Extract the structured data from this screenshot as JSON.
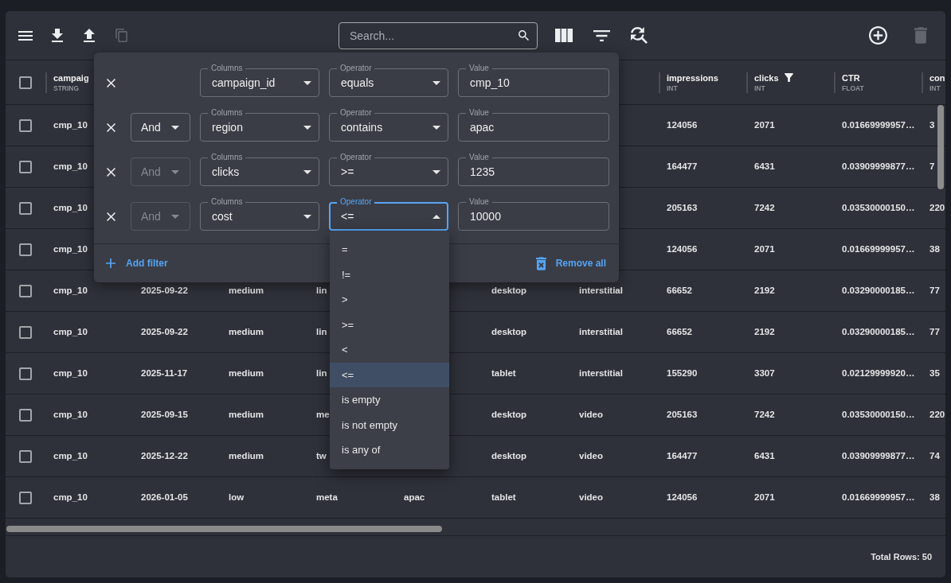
{
  "toolbar": {
    "left_actions": [
      {
        "disabled": false
      },
      {
        "disabled": false
      },
      {
        "disabled": false
      },
      {
        "disabled": true
      }
    ],
    "search": {
      "placeholder": "Search..."
    },
    "right_actions": [
      {
        "disabled": false
      },
      {
        "disabled": true
      }
    ]
  },
  "table": {
    "select_all": {
      "checked": false
    },
    "columns": {
      "column_1": {
        "label": "campaig",
        "type": "STRING",
        "filtered": false
      },
      "column_8": {
        "label": "impressions",
        "type": "INT",
        "filtered": false
      },
      "column_9": {
        "label": "clicks",
        "type": "INT",
        "filtered": true
      },
      "column_10": {
        "label": "CTR",
        "type": "FLOAT",
        "filtered": false
      },
      "column_11": {
        "label": "con",
        "type": "INT",
        "filtered": false
      }
    },
    "rows": [
      {
        "checked": false,
        "column_1": "cmp_10",
        "column_8": "124056",
        "column_9": "2071",
        "column_10": "0.01669999957…",
        "column_11": "3"
      },
      {
        "checked": false,
        "column_1": "cmp_10",
        "column_8": "164477",
        "column_9": "6431",
        "column_10": "0.03909999877…",
        "column_11": "7"
      },
      {
        "checked": false,
        "column_1": "cmp_10",
        "column_8": "205163",
        "column_9": "7242",
        "column_10": "0.03530000150…",
        "column_11": "220"
      },
      {
        "checked": false,
        "column_1": "cmp_10",
        "column_8": "124056",
        "column_9": "2071",
        "column_10": "0.01669999957…",
        "column_11": "38"
      },
      {
        "checked": false,
        "column_1": "cmp_10",
        "column_2": "2025-09-22",
        "column_3": "medium",
        "column_4": "lin",
        "column_6": "desktop",
        "column_7": "interstitial",
        "column_8": "66652",
        "column_9": "2192",
        "column_10": "0.03290000185…",
        "column_11": "77"
      },
      {
        "checked": false,
        "column_1": "cmp_10",
        "column_2": "2025-09-22",
        "column_3": "medium",
        "column_4": "lin",
        "column_6": "desktop",
        "column_7": "interstitial",
        "column_8": "66652",
        "column_9": "2192",
        "column_10": "0.03290000185…",
        "column_11": "77"
      },
      {
        "checked": false,
        "column_1": "cmp_10",
        "column_2": "2025-11-17",
        "column_3": "medium",
        "column_4": "lin",
        "column_6": "tablet",
        "column_7": "interstitial",
        "column_8": "155290",
        "column_9": "3307",
        "column_10": "0.02129999920…",
        "column_11": "35"
      },
      {
        "checked": false,
        "column_1": "cmp_10",
        "column_2": "2025-09-15",
        "column_3": "medium",
        "column_4": "me",
        "column_6": "desktop",
        "column_7": "video",
        "column_8": "205163",
        "column_9": "7242",
        "column_10": "0.03530000150…",
        "column_11": "220"
      },
      {
        "checked": false,
        "column_1": "cmp_10",
        "column_2": "2025-12-22",
        "column_3": "medium",
        "column_4": "tw",
        "column_6": "desktop",
        "column_7": "video",
        "column_8": "164477",
        "column_9": "6431",
        "column_10": "0.03909999877…",
        "column_11": "74"
      },
      {
        "checked": false,
        "column_1": "cmp_10",
        "column_2": "2026-01-05",
        "column_3": "low",
        "column_4": "meta",
        "column_5": "apac",
        "column_6": "tablet",
        "column_7": "video",
        "column_8": "124056",
        "column_9": "2071",
        "column_10": "0.01669999957…",
        "column_11": "38"
      }
    ],
    "total_rows": "Total Rows: 50"
  },
  "filter_panel": {
    "filters": [
      {
        "column_field": {
          "label": "Columns",
          "value": "campaign_id"
        },
        "operator_field": {
          "label": "Operator",
          "value": "equals",
          "expanded": false
        },
        "value_field": {
          "label": "Value",
          "value": "cmp_10"
        }
      },
      {
        "logic": {
          "value": "And",
          "disabled": false
        },
        "column_field": {
          "label": "Columns",
          "value": "region"
        },
        "operator_field": {
          "label": "Operator",
          "value": "contains",
          "expanded": false
        },
        "value_field": {
          "label": "Value",
          "value": "apac"
        }
      },
      {
        "logic": {
          "value": "And",
          "disabled": true
        },
        "column_field": {
          "label": "Columns",
          "value": "clicks"
        },
        "operator_field": {
          "label": "Operator",
          "value": ">=",
          "expanded": false
        },
        "value_field": {
          "label": "Value",
          "value": "1235"
        }
      },
      {
        "logic": {
          "value": "And",
          "disabled": true
        },
        "column_field": {
          "label": "Columns",
          "value": "cost"
        },
        "operator_field": {
          "label": "Operator",
          "value": "<=",
          "expanded": true
        },
        "value_field": {
          "label": "Value",
          "value": "10000"
        }
      }
    ],
    "add_button": "Add filter",
    "remove_all_button": "Remove all"
  },
  "operator_menu": {
    "options": [
      {
        "label": "=",
        "selected": false
      },
      {
        "label": "!=",
        "selected": false
      },
      {
        "label": ">",
        "selected": false
      },
      {
        "label": ">=",
        "selected": false
      },
      {
        "label": "<",
        "selected": false
      },
      {
        "label": "<=",
        "selected": true
      },
      {
        "label": "is empty",
        "selected": false
      },
      {
        "label": "is not empty",
        "selected": false
      },
      {
        "label": "is any of",
        "selected": false
      }
    ]
  }
}
